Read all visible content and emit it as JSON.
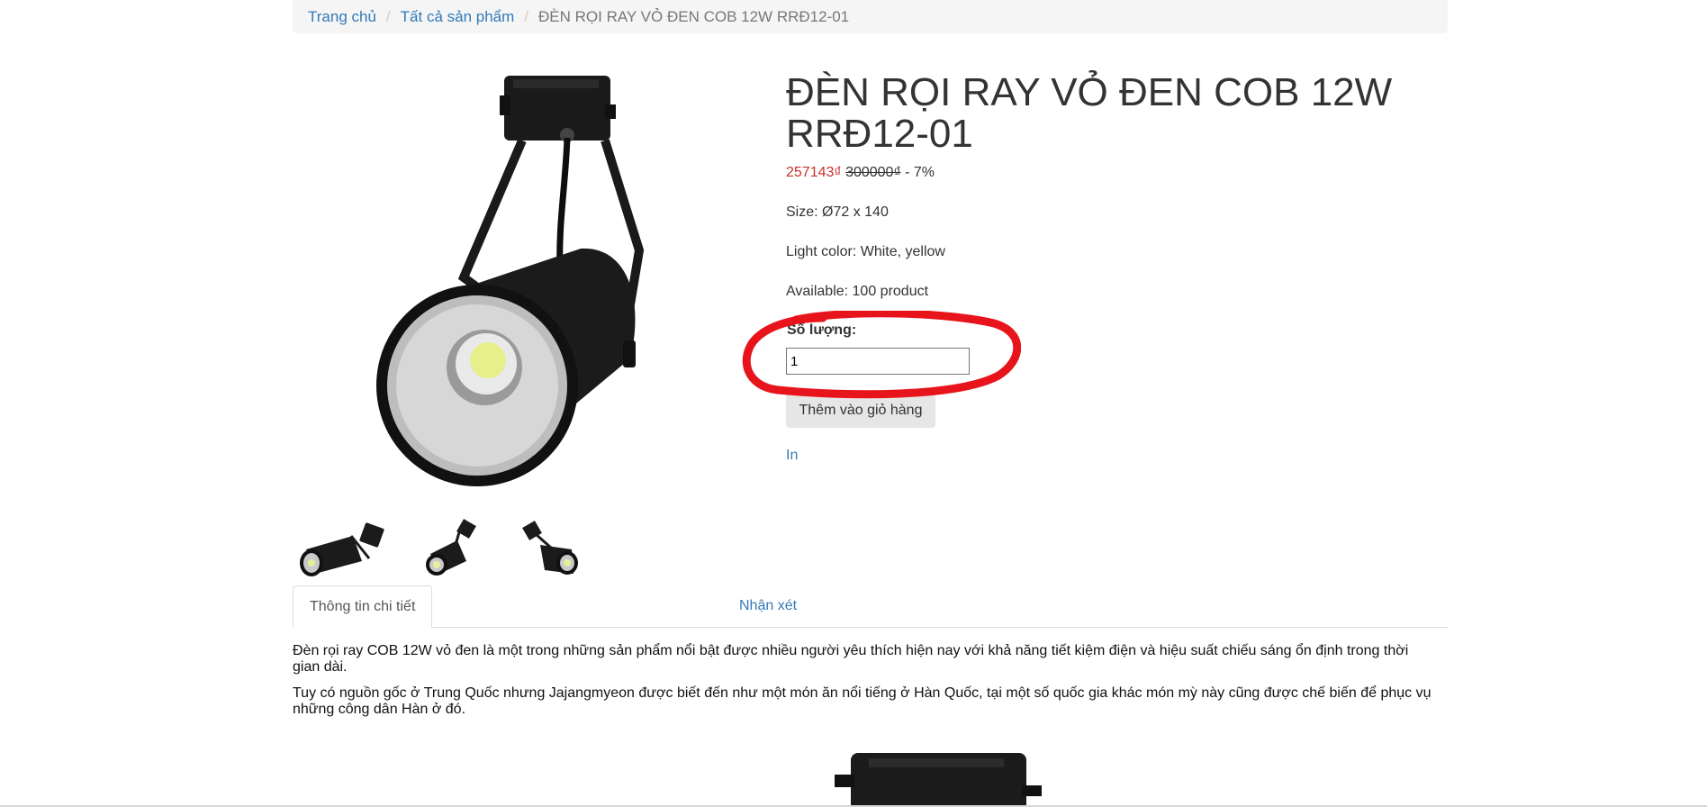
{
  "breadcrumb": {
    "home": "Trang chủ",
    "all_products": "Tất cả sản phẩm",
    "current": "ĐÈN RỌI RAY VỎ ĐEN COB 12W RRĐ12-01"
  },
  "product": {
    "title": "ĐÈN RỌI RAY VỎ ĐEN COB 12W RRĐ12-01",
    "price_new": "257143₫",
    "price_old": "300000₫",
    "discount": " - 7%",
    "size": "Size: Ø72 x 140",
    "light_color": "Light color: White, yellow",
    "available": "Available: 100 product",
    "quantity_label": "Số lượng:",
    "quantity_value": "1",
    "add_to_cart": "Thêm vào giỏ hàng",
    "print": "In"
  },
  "images": {
    "main": "track-light-icon",
    "thumbnails": [
      "track-light-thumb-1",
      "track-light-thumb-2",
      "track-light-thumb-3"
    ]
  },
  "tabs": [
    {
      "label": "Thông tin chi tiết",
      "active": true
    },
    {
      "label": "Nhận xét",
      "active": false
    }
  ],
  "description": {
    "p1": "Đèn rọi ray COB 12W vỏ đen là một trong những sản phẩm nổi bật được nhiều người yêu thích hiện nay với khả năng tiết kiệm điện và hiệu suất chiếu sáng ổn định trong thời gian dài.",
    "p2": "Tuy có nguồn gốc ở Trung Quốc nhưng Jajangmyeon được biết đến như một món ăn nổi tiếng ở Hàn Quốc, tại một số quốc gia khác món mỳ này cũng được chế biến để phục vụ những công dân Hàn ở đó."
  },
  "colors": {
    "link": "#337ab7",
    "price_new": "#c9302c",
    "annotation": "#e8141c"
  }
}
